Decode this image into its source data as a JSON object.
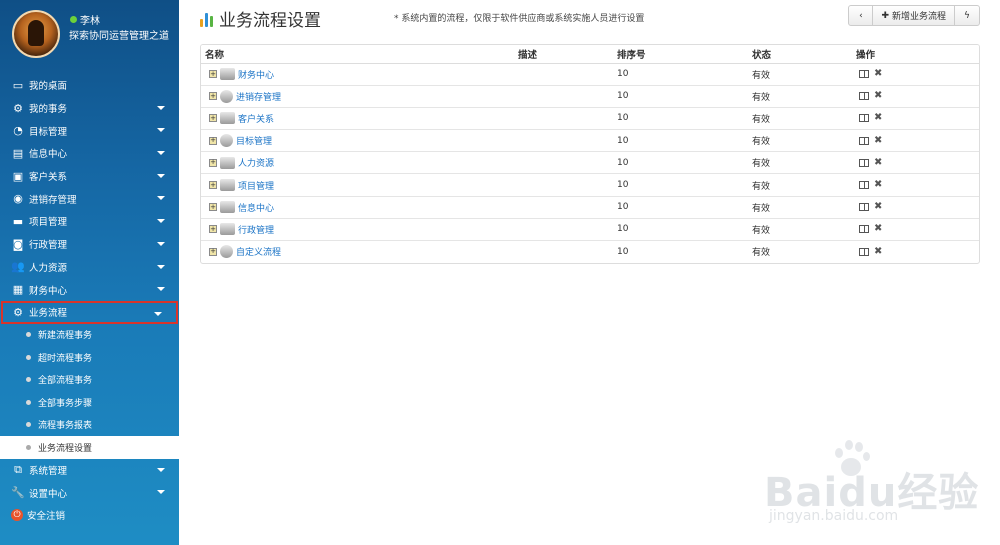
{
  "profile": {
    "username": "李林",
    "motto": "探索协同运营管理之道"
  },
  "sidebar": {
    "items": [
      {
        "label": "我的桌面",
        "icon": "monitor-icon",
        "has_caret": false
      },
      {
        "label": "我的事务",
        "icon": "gear-icon",
        "has_caret": true
      },
      {
        "label": "目标管理",
        "icon": "target-icon",
        "has_caret": true
      },
      {
        "label": "信息中心",
        "icon": "database-icon",
        "has_caret": true
      },
      {
        "label": "客户关系",
        "icon": "contact-card-icon",
        "has_caret": true
      },
      {
        "label": "进销存管理",
        "icon": "disc-icon",
        "has_caret": true
      },
      {
        "label": "项目管理",
        "icon": "folder-icon",
        "has_caret": true
      },
      {
        "label": "行政管理",
        "icon": "camera-icon",
        "has_caret": true
      },
      {
        "label": "人力资源",
        "icon": "users-icon",
        "has_caret": true
      },
      {
        "label": "财务中心",
        "icon": "calculator-icon",
        "has_caret": true
      },
      {
        "label": "业务流程",
        "icon": "gear-icon",
        "has_caret": true,
        "active": true
      }
    ],
    "sub_items": [
      {
        "label": "新建流程事务"
      },
      {
        "label": "超时流程事务"
      },
      {
        "label": "全部流程事务"
      },
      {
        "label": "全部事务步骤"
      },
      {
        "label": "流程事务报表"
      },
      {
        "label": "业务流程设置",
        "current": true
      }
    ],
    "bottom_items": [
      {
        "label": "系统管理",
        "icon": "system-icon",
        "has_caret": true
      },
      {
        "label": "设置中心",
        "icon": "wrench-icon",
        "has_caret": true
      },
      {
        "label": "安全注销",
        "icon": "power-icon",
        "has_caret": false
      }
    ]
  },
  "header": {
    "title": "业务流程设置",
    "notice": "* 系统内置的流程，仅限于软件供应商或系统实施人员进行设置",
    "new_button": "新增业务流程"
  },
  "table": {
    "columns": [
      "名称",
      "描述",
      "排序号",
      "状态",
      "操作"
    ],
    "rows": [
      {
        "name": "财务中心",
        "icon": "database-icon",
        "desc": "",
        "order": "10",
        "status": "有效"
      },
      {
        "name": "进销存管理",
        "icon": "disc-icon",
        "desc": "",
        "order": "10",
        "status": "有效"
      },
      {
        "name": "客户关系",
        "icon": "contact-card-icon",
        "desc": "",
        "order": "10",
        "status": "有效"
      },
      {
        "name": "目标管理",
        "icon": "target-icon",
        "desc": "",
        "order": "10",
        "status": "有效"
      },
      {
        "name": "人力资源",
        "icon": "users-icon",
        "desc": "",
        "order": "10",
        "status": "有效"
      },
      {
        "name": "项目管理",
        "icon": "folder-icon",
        "desc": "",
        "order": "10",
        "status": "有效"
      },
      {
        "name": "信息中心",
        "icon": "database-icon",
        "desc": "",
        "order": "10",
        "status": "有效"
      },
      {
        "name": "行政管理",
        "icon": "camera-icon",
        "desc": "",
        "order": "10",
        "status": "有效"
      },
      {
        "name": "自定义流程",
        "icon": "gear-icon",
        "desc": "",
        "order": "10",
        "status": "有效"
      }
    ]
  },
  "watermark": {
    "brand": "Bai",
    "brand2": "du",
    "brand3": "经验",
    "url": "jingyan.baidu.com"
  },
  "colors": {
    "sidebar_top": "#0f4f86",
    "sidebar_bottom": "#1e8dc4",
    "active_border": "#d9342b",
    "link": "#1a73c6"
  }
}
